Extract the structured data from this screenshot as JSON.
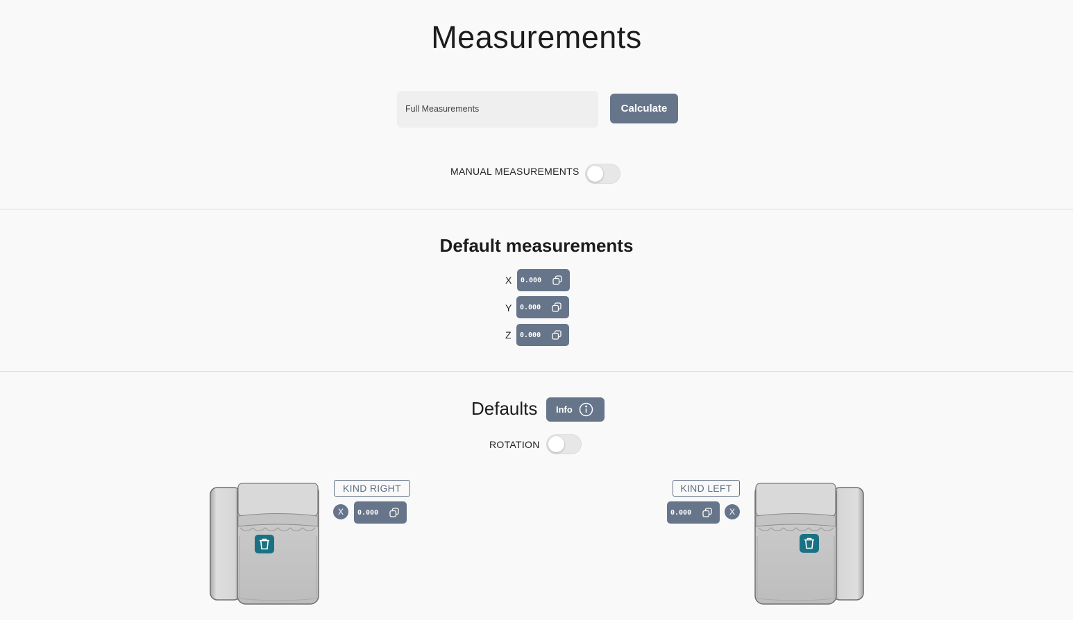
{
  "header": {
    "title": "Measurements"
  },
  "form": {
    "select_value": "Full Measurements",
    "calculate_label": "Calculate",
    "manual_label": "MANUAL MEASUREMENTS",
    "manual_enabled": false
  },
  "default_measurements": {
    "title": "Default measurements",
    "rows": [
      {
        "axis": "X",
        "value": "0.000"
      },
      {
        "axis": "Y",
        "value": "0.000"
      },
      {
        "axis": "Z",
        "value": "0.000"
      }
    ]
  },
  "defaults": {
    "title": "Defaults",
    "info_label": "Info",
    "rotation_label": "ROTATION",
    "rotation_enabled": false,
    "items": [
      {
        "kind": "KIND RIGHT",
        "axis": "X",
        "value": "0.000"
      },
      {
        "kind": "KIND LEFT",
        "axis": "X",
        "value": "0.000"
      }
    ]
  },
  "colors": {
    "accent": "#66758a",
    "trash": "#1a7183",
    "background": "#f9f9f9"
  }
}
